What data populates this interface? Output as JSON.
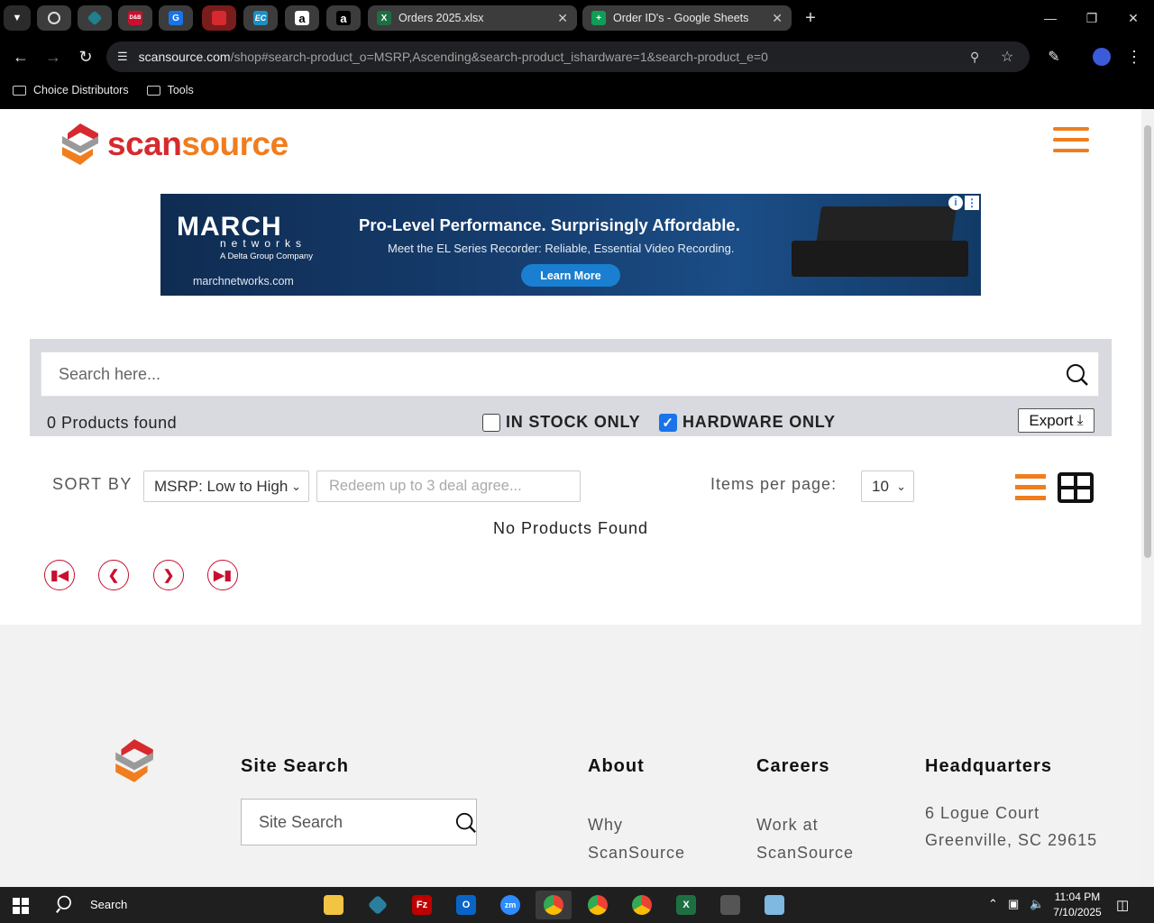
{
  "browser": {
    "tabs": [
      {
        "icon": "chatgpt-icon",
        "active": false
      },
      {
        "icon": "perplexity-icon",
        "active": false
      },
      {
        "icon": "dnb-icon",
        "label": "D&B",
        "active": false
      },
      {
        "icon": "g-blue-icon",
        "label": "G",
        "active": false
      },
      {
        "icon": "scansource-icon",
        "active": true
      },
      {
        "icon": "ec-icon",
        "label": "EC",
        "active": false
      },
      {
        "icon": "amazon-icon",
        "label": "a",
        "active": false
      },
      {
        "icon": "amazon-icon",
        "label": "a",
        "active": false
      }
    ],
    "tab_excel": {
      "title": "Orders 2025.xlsx"
    },
    "tab_sheets": {
      "title": "Order ID's - Google Sheets"
    },
    "url_domain": "scansource.com",
    "url_path": "/shop#search-product_o=MSRP,Ascending&search-product_ishardware=1&search-product_e=0",
    "bookmarks": [
      "Choice Distributors",
      "Tools"
    ]
  },
  "site": {
    "logo_scan": "scan",
    "logo_source": "source",
    "banner": {
      "brand": "MARCH",
      "networks": "networks",
      "delta": "A Delta Group Company",
      "site": "marchnetworks.com",
      "headline": "Pro-Level Performance. Surprisingly Affordable.",
      "sub": "Meet the EL Series Recorder: Reliable, Essential Video Recording.",
      "cta": "Learn More"
    },
    "search": {
      "placeholder": "Search here..."
    },
    "found_text": "0 Products found",
    "in_stock_label": "IN STOCK ONLY",
    "in_stock_checked": false,
    "hardware_label": "HARDWARE ONLY",
    "hardware_checked": true,
    "export_label": "Export",
    "sort_label": "SORT BY",
    "sort_value": "MSRP: Low to High",
    "promo_placeholder": "Redeem up to 3 deal agree...",
    "items_per_page_label": "Items per page:",
    "items_per_page_value": "10",
    "no_products": "No Products Found",
    "footer": {
      "site_search_heading": "Site Search",
      "site_search_placeholder": "Site Search",
      "about_heading": "About",
      "about_link": "Why ScanSource",
      "careers_heading": "Careers",
      "careers_link": "Work at ScanSource",
      "hq_heading": "Headquarters",
      "hq_address": "6 Logue Court Greenville, SC 29615"
    }
  },
  "taskbar": {
    "search_label": "Search",
    "time": "11:04 PM",
    "date": "7/10/2025"
  },
  "colors": {
    "brand_orange": "#f07d1e",
    "brand_red": "#d62a2e",
    "pager_red": "#c8102e",
    "checkbox_blue": "#1a73e8"
  }
}
